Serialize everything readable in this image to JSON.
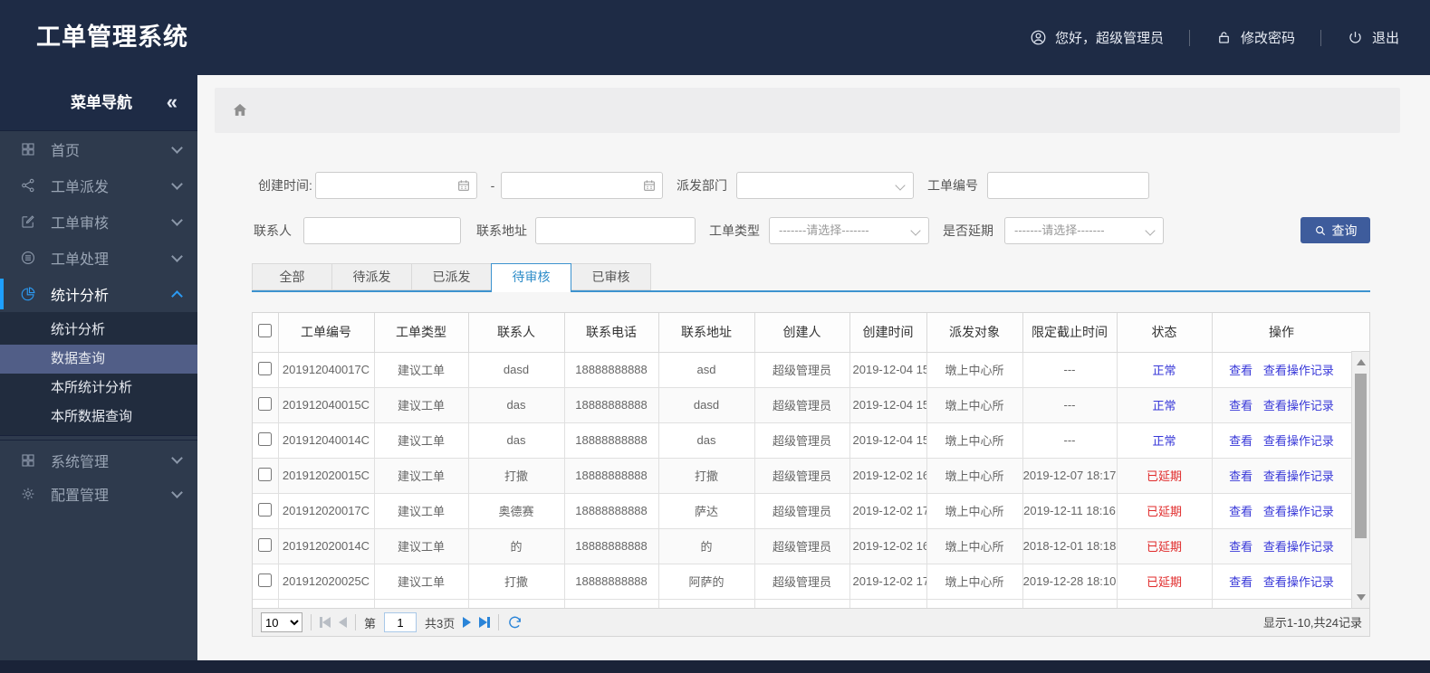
{
  "header": {
    "title": "工单管理系统",
    "greeting": "您好，超级管理员",
    "change_password": "修改密码",
    "logout": "退出"
  },
  "sidebar": {
    "title": "菜单导航",
    "collapse": "«",
    "items": [
      {
        "label": "首页",
        "icon": "grid-icon"
      },
      {
        "label": "工单派发",
        "icon": "share-icon"
      },
      {
        "label": "工单审核",
        "icon": "edit-icon"
      },
      {
        "label": "工单处理",
        "icon": "process-icon"
      },
      {
        "label": "统计分析",
        "icon": "pie-chart-icon",
        "active": true,
        "expanded": true
      },
      {
        "label": "系统管理",
        "icon": "grid-icon"
      },
      {
        "label": "配置管理",
        "icon": "gear-icon"
      }
    ],
    "submenu": [
      {
        "label": "统计分析"
      },
      {
        "label": "数据查询",
        "selected": true
      },
      {
        "label": "本所统计分析"
      },
      {
        "label": "本所数据查询"
      }
    ]
  },
  "filters": {
    "create_time_label": "创建时间:",
    "range_separator": "-",
    "dispatch_dept_label": "派发部门",
    "order_no_label": "工单编号",
    "contact_label": "联系人",
    "address_label": "联系地址",
    "order_type_label": "工单类型",
    "delay_label": "是否延期",
    "select_placeholder": "-------请选择-------",
    "search_button": "查询"
  },
  "tabs": [
    {
      "label": "全部"
    },
    {
      "label": "待派发"
    },
    {
      "label": "已派发"
    },
    {
      "label": "待审核",
      "active": true
    },
    {
      "label": "已审核"
    }
  ],
  "table": {
    "columns": [
      "工单编号",
      "工单类型",
      "联系人",
      "联系电话",
      "联系地址",
      "创建人",
      "创建时间",
      "派发对象",
      "限定截止时间",
      "状态",
      "操作"
    ],
    "view_label": "查看",
    "view_log_label": "查看操作记录",
    "rows": [
      {
        "order_no": "201912040017C",
        "type": "建议工单",
        "contact": "dasd",
        "phone": "18888888888",
        "address": "asd",
        "creator": "超级管理员",
        "created": "2019-12-04 15",
        "target": "墩上中心所",
        "deadline": "---",
        "status": "正常",
        "status_type": "normal"
      },
      {
        "order_no": "201912040015C",
        "type": "建议工单",
        "contact": "das",
        "phone": "18888888888",
        "address": "dasd",
        "creator": "超级管理员",
        "created": "2019-12-04 15",
        "target": "墩上中心所",
        "deadline": "---",
        "status": "正常",
        "status_type": "normal"
      },
      {
        "order_no": "201912040014C",
        "type": "建议工单",
        "contact": "das",
        "phone": "18888888888",
        "address": "das",
        "creator": "超级管理员",
        "created": "2019-12-04 15",
        "target": "墩上中心所",
        "deadline": "---",
        "status": "正常",
        "status_type": "normal"
      },
      {
        "order_no": "201912020015C",
        "type": "建议工单",
        "contact": "打撒",
        "phone": "18888888888",
        "address": "打撒",
        "creator": "超级管理员",
        "created": "2019-12-02 16",
        "target": "墩上中心所",
        "deadline": "2019-12-07 18:17",
        "status": "已延期",
        "status_type": "delayed"
      },
      {
        "order_no": "201912020017C",
        "type": "建议工单",
        "contact": "奥德赛",
        "phone": "18888888888",
        "address": "萨达",
        "creator": "超级管理员",
        "created": "2019-12-02 17",
        "target": "墩上中心所",
        "deadline": "2019-12-11 18:16",
        "status": "已延期",
        "status_type": "delayed"
      },
      {
        "order_no": "201912020014C",
        "type": "建议工单",
        "contact": "的",
        "phone": "18888888888",
        "address": "的",
        "creator": "超级管理员",
        "created": "2019-12-02 16",
        "target": "墩上中心所",
        "deadline": "2018-12-01 18:18",
        "status": "已延期",
        "status_type": "delayed"
      },
      {
        "order_no": "201912020025C",
        "type": "建议工单",
        "contact": "打撒",
        "phone": "18888888888",
        "address": "阿萨的",
        "creator": "超级管理员",
        "created": "2019-12-02 17",
        "target": "墩上中心所",
        "deadline": "2019-12-28 18:10",
        "status": "已延期",
        "status_type": "delayed"
      }
    ]
  },
  "pagination": {
    "page_size": "10",
    "page_prefix": "第",
    "current_page": "1",
    "total_pages": "共3页",
    "summary": "显示1-10,共24记录"
  },
  "colors": {
    "header_bg": "#1e2b45",
    "sidebar_bg": "#2e3a4d",
    "accent_blue": "#2b9af3",
    "tab_active_blue": "#2d8cc8",
    "link_blue": "#3737d8",
    "status_normal": "#3737d8",
    "status_delayed": "#e02a2a",
    "search_button_bg": "#3e5c9c",
    "footer_bg": "#1a2338"
  }
}
